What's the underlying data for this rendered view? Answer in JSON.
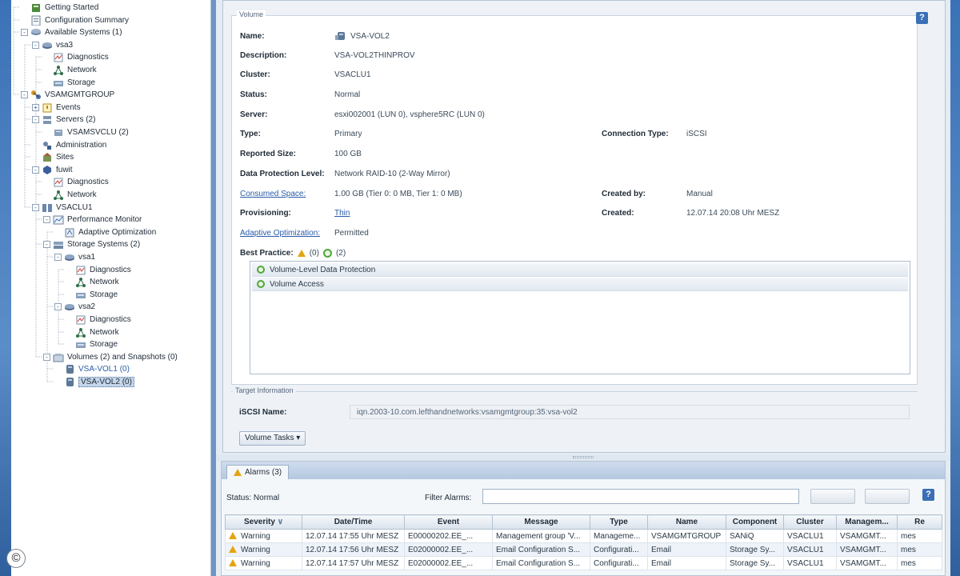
{
  "tree": {
    "items": [
      {
        "label": "Getting Started",
        "depth": 1,
        "icon": "book",
        "toggle": ""
      },
      {
        "label": "Configuration Summary",
        "depth": 1,
        "icon": "summary",
        "toggle": ""
      },
      {
        "label": "Available Systems (1)",
        "depth": 1,
        "icon": "server-group",
        "toggle": "-"
      },
      {
        "label": "vsa3",
        "depth": 2,
        "icon": "storage-node",
        "toggle": "-"
      },
      {
        "label": "Diagnostics",
        "depth": 3,
        "icon": "diagnostics",
        "toggle": ""
      },
      {
        "label": "Network",
        "depth": 3,
        "icon": "network",
        "toggle": ""
      },
      {
        "label": "Storage",
        "depth": 3,
        "icon": "storage",
        "toggle": ""
      },
      {
        "label": "VSAMGMTGROUP",
        "depth": 1,
        "icon": "mgmt-group",
        "toggle": "-"
      },
      {
        "label": "Events",
        "depth": 2,
        "icon": "events",
        "toggle": "+"
      },
      {
        "label": "Servers (2)",
        "depth": 2,
        "icon": "servers",
        "toggle": "-"
      },
      {
        "label": "VSAMSVCLU (2)",
        "depth": 3,
        "icon": "server",
        "toggle": ""
      },
      {
        "label": "Administration",
        "depth": 2,
        "icon": "admin",
        "toggle": ""
      },
      {
        "label": "Sites",
        "depth": 2,
        "icon": "sites",
        "toggle": ""
      },
      {
        "label": "fuwit",
        "depth": 2,
        "icon": "fom",
        "toggle": "-"
      },
      {
        "label": "Diagnostics",
        "depth": 3,
        "icon": "diagnostics",
        "toggle": ""
      },
      {
        "label": "Network",
        "depth": 3,
        "icon": "network",
        "toggle": ""
      },
      {
        "label": "VSACLU1",
        "depth": 2,
        "icon": "cluster",
        "toggle": "-"
      },
      {
        "label": "Performance Monitor",
        "depth": 3,
        "icon": "perf",
        "toggle": "-"
      },
      {
        "label": "Adaptive Optimization",
        "depth": 4,
        "icon": "adaptive",
        "toggle": ""
      },
      {
        "label": "Storage Systems (2)",
        "depth": 3,
        "icon": "storage-systems",
        "toggle": "-"
      },
      {
        "label": "vsa1",
        "depth": 4,
        "icon": "storage-node",
        "toggle": "-"
      },
      {
        "label": "Diagnostics",
        "depth": 5,
        "icon": "diagnostics",
        "toggle": ""
      },
      {
        "label": "Network",
        "depth": 5,
        "icon": "network",
        "toggle": ""
      },
      {
        "label": "Storage",
        "depth": 5,
        "icon": "storage",
        "toggle": ""
      },
      {
        "label": "vsa2",
        "depth": 4,
        "icon": "storage-node",
        "toggle": "-"
      },
      {
        "label": "Diagnostics",
        "depth": 5,
        "icon": "diagnostics",
        "toggle": ""
      },
      {
        "label": "Network",
        "depth": 5,
        "icon": "network",
        "toggle": ""
      },
      {
        "label": "Storage",
        "depth": 5,
        "icon": "storage",
        "toggle": ""
      },
      {
        "label": "Volumes (2) and Snapshots (0)",
        "depth": 3,
        "icon": "volumes",
        "toggle": "-"
      },
      {
        "label": "VSA-VOL1 (0)",
        "depth": 4,
        "icon": "volume",
        "toggle": "",
        "link": true
      },
      {
        "label": "VSA-VOL2 (0)",
        "depth": 4,
        "icon": "volume",
        "toggle": "",
        "selected": true
      }
    ]
  },
  "details": {
    "group_title": "Volume",
    "fields": {
      "name_label": "Name:",
      "name_value": "VSA-VOL2",
      "desc_label": "Description:",
      "desc_value": "VSA-VOL2THINPROV",
      "cluster_label": "Cluster:",
      "cluster_value": "VSACLU1",
      "status_label": "Status:",
      "status_value": "Normal",
      "server_label": "Server:",
      "server_value": "esxi002001 (LUN 0), vsphere5RC (LUN 0)",
      "type_label": "Type:",
      "type_value": "Primary",
      "conn_label": "Connection Type:",
      "conn_value": "iSCSI",
      "size_label": "Reported Size:",
      "size_value": "100 GB",
      "dpl_label": "Data Protection Level:",
      "dpl_value": "Network RAID-10 (2-Way Mirror)",
      "consumed_label": "Consumed Space:",
      "consumed_value": "1.00 GB (Tier 0: 0 MB, Tier 1: 0 MB)",
      "createdby_label": "Created by:",
      "createdby_value": "Manual",
      "prov_label": "Provisioning:",
      "prov_value": "Thin",
      "created_label": "Created:",
      "created_value": "12.07.14 20:08 Uhr MESZ",
      "ao_label": "Adaptive Optimization:",
      "ao_value": "Permitted",
      "bp_label": "Best Practice:",
      "bp_warn_count": "(0)",
      "bp_ok_count": "(2)"
    },
    "best_practice_items": [
      "Volume-Level Data Protection",
      "Volume Access"
    ],
    "target_title": "Target Information",
    "iqn_label": "iSCSI Name:",
    "iqn_value": "iqn.2003-10.com.lefthandnetworks:vsamgmtgroup:35:vsa-vol2",
    "tasks_button": "Volume Tasks ▾",
    "help": "?"
  },
  "alarms": {
    "tab_label": "Alarms (3)",
    "status_label": "Status:",
    "status_value": "Normal",
    "filter_label": "Filter Alarms:",
    "help": "?",
    "columns": [
      "Severity",
      "Date/Time",
      "Event",
      "Message",
      "Type",
      "Name",
      "Component",
      "Cluster",
      "Managem...",
      "Re"
    ],
    "rows": [
      [
        "Warning",
        "12.07.14 17:55 Uhr MESZ",
        "E00000202.EE_...",
        "Management group 'V...",
        "Manageme...",
        "VSAMGMTGROUP",
        "SANiQ",
        "VSACLU1",
        "VSAMGMT...",
        "mes"
      ],
      [
        "Warning",
        "12.07.14 17:56 Uhr MESZ",
        "E02000002.EE_...",
        "Email Configuration S...",
        "Configurati...",
        "Email",
        "Storage Sy...",
        "VSACLU1",
        "VSAMGMT...",
        "mes"
      ],
      [
        "Warning",
        "12.07.14 17:57 Uhr MESZ",
        "E02000002.EE_...",
        "Email Configuration S...",
        "Configurati...",
        "Email",
        "Storage Sy...",
        "VSACLU1",
        "VSAMGMT...",
        "mes"
      ]
    ]
  },
  "copyright_symbol": "©",
  "colors": {
    "accent": "#3a6fb6",
    "warning": "#e3a40f",
    "ok": "#52a63a",
    "link": "#2a5ca8"
  }
}
